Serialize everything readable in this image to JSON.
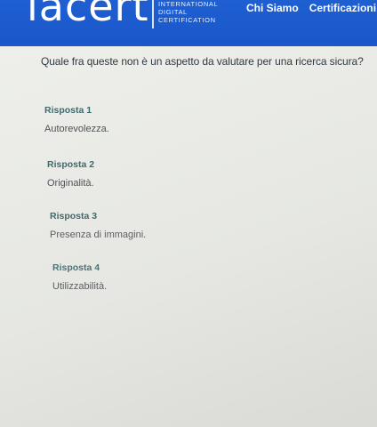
{
  "header": {
    "logo_text": "iacert",
    "logo_sub": [
      "INTERNATIONAL",
      "DIGITAL",
      "CERTIFICATION"
    ],
    "nav": [
      "Chi Siamo",
      "Certificazioni"
    ],
    "bg_color": "#1a57c9"
  },
  "question": "Quale fra queste non è un aspetto da valutare per una ricerca sicura?",
  "answers": [
    {
      "label": "Risposta 1",
      "text": "Autorevolezza."
    },
    {
      "label": "Risposta 2",
      "text": "Originalità."
    },
    {
      "label": "Risposta 3",
      "text": "Presenza di immagini."
    },
    {
      "label": "Risposta 4",
      "text": "Utilizzabilità."
    }
  ]
}
